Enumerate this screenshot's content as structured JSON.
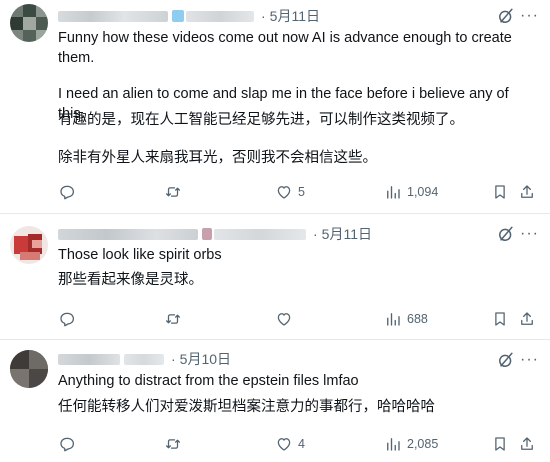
{
  "replies": [
    {
      "date": "5月11日",
      "separator": "·",
      "text_en": "Funny how these videos come out now AI is advance enough to create them.",
      "text_en2": "I need an alien to come and slap me in the face before i believe any of this.",
      "text_zh": "有趣的是，现在人工智能已经足够先进，可以制作这类视频了。",
      "text_zh2": "除非有外星人来扇我耳光，否则我不会相信这些。",
      "likes": "5",
      "views": "1,094"
    },
    {
      "date": "5月11日",
      "separator": "·",
      "text_en": "Those look like spirit orbs",
      "text_zh": "那些看起来像是灵球。",
      "likes": "",
      "views": "688"
    },
    {
      "date": "5月10日",
      "separator": "·",
      "text_en": "Anything to distract from the epstein files lmfao",
      "text_zh": "任何能转移人们对爱泼斯坦档案注意力的事都行，哈哈哈哈",
      "likes": "4",
      "views": "2,085"
    }
  ],
  "icons": {
    "grok": "grok-icon",
    "more": "more-options-icon",
    "reply": "reply-icon",
    "repost": "repost-icon",
    "like": "like-icon",
    "views": "views-icon",
    "share": "share-icon"
  },
  "colors": {
    "text": "#0f1419",
    "secondary": "#536471",
    "divider": "#e6e9eb"
  }
}
